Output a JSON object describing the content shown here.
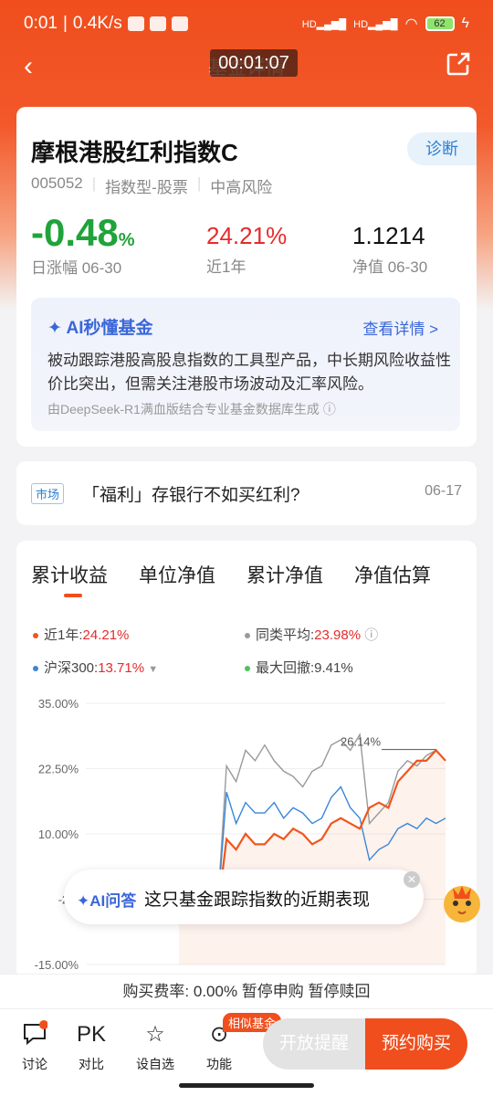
{
  "status": {
    "time": "0:01",
    "speed": "0.4K/s",
    "battery": "62"
  },
  "nav": {
    "title": "基金详情",
    "timer": "00:01:07"
  },
  "fund": {
    "name": "摩根港股红利指数C",
    "diagnose": "诊断",
    "code": "005052",
    "type": "指数型-股票",
    "risk": "中高风险",
    "daily_change": "-0.48",
    "daily_unit": "%",
    "daily_label": "日涨幅 06-30",
    "year_return": "24.21%",
    "year_label": "近1年",
    "nav_value": "1.1214",
    "nav_label": "净值 06-30"
  },
  "ai": {
    "title": "AI秒懂基金",
    "more": "查看详情 >",
    "text": "被动跟踪港股高股息指数的工具型产品，中长期风险收益性价比突出，但需关注港股市场波动及汇率风险。",
    "source": "由DeepSeek-R1满血版结合专业基金数据库生成 ⓘ"
  },
  "news": {
    "tag": "市场",
    "title": "「福利」存银行不如买红利?",
    "date": "06-17"
  },
  "chart_tabs": [
    "累计收益",
    "单位净值",
    "累计净值",
    "净值估算"
  ],
  "legend": {
    "fund_label": "近1年:",
    "fund_value": "24.21%",
    "peer_label": "同类平均:",
    "peer_value": "23.98%",
    "index_label": "沪深300:",
    "index_value": "13.71%",
    "dd_label": "最大回撤:",
    "dd_value": "9.41%"
  },
  "colors": {
    "fund": "#f0561d",
    "peer": "#9a9a9a",
    "index": "#3a86d8",
    "drawdown": "#4cc45a",
    "accent": "#f04e1d"
  },
  "chart_data": {
    "type": "line",
    "yticks": [
      "35.00%",
      "22.50%",
      "10.00%",
      "-2.5",
      "-15.00%"
    ],
    "ylim": [
      -15,
      35
    ],
    "annotation": "26.14%",
    "series": [
      {
        "name": "近1年",
        "values": [
          0,
          -1,
          -3,
          -2,
          -6,
          9,
          7,
          10,
          8,
          8,
          10,
          9,
          11,
          10,
          8,
          9,
          12,
          13,
          12,
          11,
          15,
          16,
          15,
          20,
          22,
          24,
          24,
          26,
          24
        ]
      },
      {
        "name": "同类平均",
        "values": [
          0,
          -1,
          -3,
          -2,
          -6,
          23,
          20,
          26,
          24,
          27,
          24,
          22,
          21,
          19,
          22,
          23,
          27,
          28,
          26,
          29,
          12,
          14,
          16,
          22,
          24,
          23,
          25,
          26,
          24
        ]
      },
      {
        "name": "沪深300",
        "values": [
          0,
          -1,
          -3,
          -2,
          -6,
          18,
          12,
          16,
          14,
          14,
          16,
          13,
          15,
          14,
          12,
          13,
          17,
          19,
          15,
          13,
          5,
          7,
          8,
          11,
          12,
          11,
          13,
          12,
          13
        ]
      }
    ]
  },
  "chat": {
    "label": "✦AI问答",
    "text": "这只基金跟踪指数的近期表现"
  },
  "fee": {
    "text": "购买费率: 0.00% 暂停申购 暂停赎回"
  },
  "bottom": {
    "discuss": "讨论",
    "pk": "PK",
    "compare": "对比",
    "watch": "设自选",
    "func": "功能",
    "badge": "相似基金",
    "open": "开放提醒",
    "buy": "预约购买"
  }
}
